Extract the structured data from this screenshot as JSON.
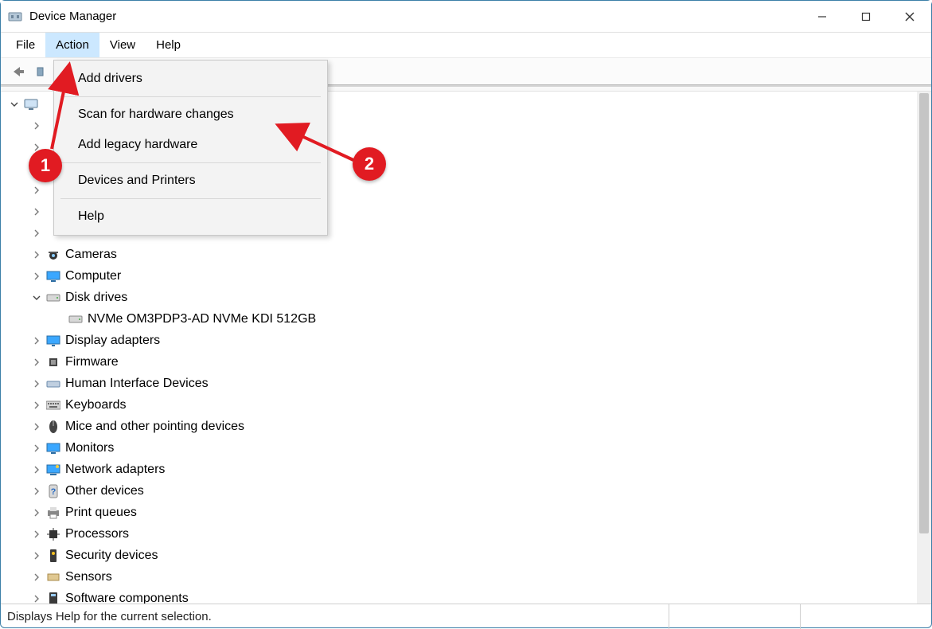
{
  "titlebar": {
    "title": "Device Manager"
  },
  "menubar": {
    "items": [
      {
        "label": "File"
      },
      {
        "label": "Action"
      },
      {
        "label": "View"
      },
      {
        "label": "Help"
      }
    ],
    "active_index": 1
  },
  "dropdown": {
    "groups": [
      [
        {
          "label": "Add drivers"
        }
      ],
      [
        {
          "label": "Scan for hardware changes"
        },
        {
          "label": "Add legacy hardware"
        }
      ],
      [
        {
          "label": "Devices and Printers"
        }
      ],
      [
        {
          "label": "Help"
        }
      ]
    ]
  },
  "tree": {
    "root": {
      "label": "",
      "expanded": true,
      "icon": "computer-root-icon"
    },
    "nodes": [
      {
        "label": "",
        "icon": "",
        "expander": "right",
        "indent": 1
      },
      {
        "label": "",
        "icon": "",
        "expander": "right",
        "indent": 1
      },
      {
        "label": "",
        "icon": "",
        "expander": "right",
        "indent": 1
      },
      {
        "label": "",
        "icon": "",
        "expander": "right",
        "indent": 1
      },
      {
        "label": "",
        "icon": "",
        "expander": "right",
        "indent": 1
      },
      {
        "label": "",
        "icon": "",
        "expander": "right",
        "indent": 1
      },
      {
        "label": "Cameras",
        "icon": "camera-icon",
        "expander": "right",
        "indent": 1
      },
      {
        "label": "Computer",
        "icon": "monitor-icon",
        "expander": "right",
        "indent": 1
      },
      {
        "label": "Disk drives",
        "icon": "disk-icon",
        "expander": "down",
        "indent": 1
      },
      {
        "label": "NVMe OM3PDP3-AD NVMe KDI 512GB",
        "icon": "disk-icon",
        "expander": "none",
        "indent": 2
      },
      {
        "label": "Display adapters",
        "icon": "display-icon",
        "expander": "right",
        "indent": 1
      },
      {
        "label": "Firmware",
        "icon": "chip-icon",
        "expander": "right",
        "indent": 1
      },
      {
        "label": "Human Interface Devices",
        "icon": "hid-icon",
        "expander": "right",
        "indent": 1
      },
      {
        "label": "Keyboards",
        "icon": "keyboard-icon",
        "expander": "right",
        "indent": 1
      },
      {
        "label": "Mice and other pointing devices",
        "icon": "mouse-icon",
        "expander": "right",
        "indent": 1
      },
      {
        "label": "Monitors",
        "icon": "monitor-icon",
        "expander": "right",
        "indent": 1
      },
      {
        "label": "Network adapters",
        "icon": "network-icon",
        "expander": "right",
        "indent": 1
      },
      {
        "label": "Other devices",
        "icon": "unknown-icon",
        "expander": "right",
        "indent": 1
      },
      {
        "label": "Print queues",
        "icon": "printer-icon",
        "expander": "right",
        "indent": 1
      },
      {
        "label": "Processors",
        "icon": "cpu-icon",
        "expander": "right",
        "indent": 1
      },
      {
        "label": "Security devices",
        "icon": "security-icon",
        "expander": "right",
        "indent": 1
      },
      {
        "label": "Sensors",
        "icon": "sensor-icon",
        "expander": "right",
        "indent": 1
      },
      {
        "label": "Software components",
        "icon": "software-icon",
        "expander": "right",
        "indent": 1
      }
    ]
  },
  "statusbar": {
    "text": "Displays Help for the current selection."
  },
  "annotations": {
    "b1": "1",
    "b2": "2"
  }
}
